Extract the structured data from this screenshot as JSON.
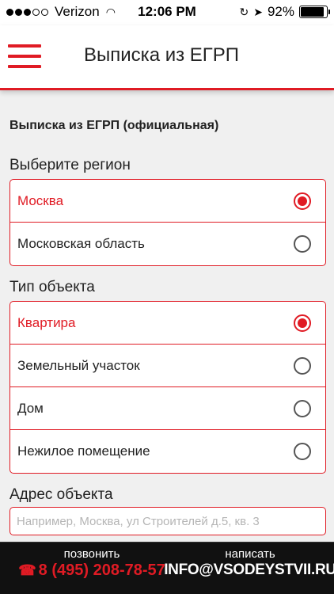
{
  "status_bar": {
    "carrier": "Verizon",
    "time": "12:06 PM",
    "battery": "92%",
    "battery_level": 0.92,
    "signal_bars": 3
  },
  "nav": {
    "title": "Выписка из ЕГРП",
    "menu_icon": "hamburger-menu-icon"
  },
  "form": {
    "title": "Выписка из ЕГРП (официальная)",
    "region": {
      "label": "Выберите регион",
      "options": [
        {
          "label": "Москва",
          "selected": true
        },
        {
          "label": "Московская область",
          "selected": false
        }
      ]
    },
    "object_type": {
      "label": "Тип объекта",
      "options": [
        {
          "label": "Квартира",
          "selected": true
        },
        {
          "label": "Земельный участок",
          "selected": false
        },
        {
          "label": "Дом",
          "selected": false
        },
        {
          "label": "Нежилое помещение",
          "selected": false
        }
      ]
    },
    "address": {
      "label": "Адрес объекта",
      "value": "",
      "placeholder": "Например, Москва, ул Строителей д.5, кв. 3"
    }
  },
  "footer": {
    "call_label": "позвонить",
    "phone": "8 (495) 208-78-57",
    "write_label": "написать",
    "email": "INFO@VSODEYSTVII.RU"
  },
  "colors": {
    "accent": "#e01b24",
    "background": "#f0f0f0",
    "footer_bg": "#111111"
  }
}
